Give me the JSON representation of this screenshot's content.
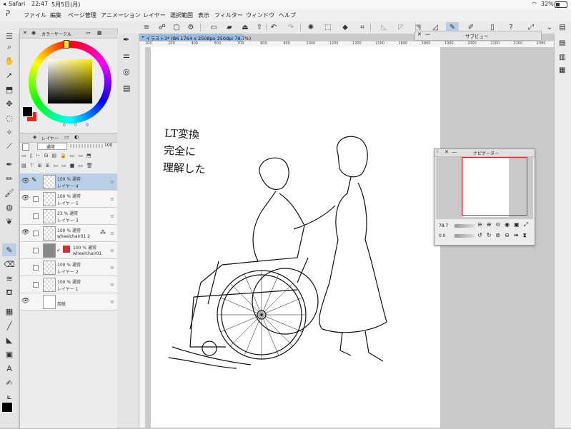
{
  "status_bar": {
    "app": "Safari",
    "time": "22:47",
    "date": "5月5日(月)",
    "battery": "32%"
  },
  "menu": {
    "items": [
      "ファイル",
      "編集",
      "ページ管理",
      "アニメーション",
      "レイヤー",
      "選択範囲",
      "表示",
      "フィルター",
      "ウィンドウ",
      "ヘルプ"
    ]
  },
  "color_panel": {
    "title": "カラーサークル",
    "values": [
      "0",
      "0",
      "0"
    ]
  },
  "layer_panel": {
    "tab_label": "レイヤー",
    "blend_mode": "通常",
    "opacity": "100",
    "layers": [
      {
        "mode": "100 % 通常",
        "name": "レイヤー 4",
        "selected": true,
        "visible": true
      },
      {
        "mode": "100 % 通常",
        "name": "レイヤー 5",
        "selected": false,
        "visible": true
      },
      {
        "mode": "23 % 通常",
        "name": "レイヤー 3",
        "selected": false,
        "visible": false
      },
      {
        "mode": "100 % 通常",
        "name": "wheelchair01 2",
        "selected": false,
        "visible": true
      },
      {
        "mode": "100 % 通常",
        "name": "wheelchair01",
        "selected": false,
        "visible": false
      },
      {
        "mode": "100 % 通常",
        "name": "レイヤー 2",
        "selected": false,
        "visible": false
      },
      {
        "mode": "100 % 通常",
        "name": "レイヤー 1",
        "selected": false,
        "visible": false
      },
      {
        "mode": "",
        "name": "用紙",
        "selected": false,
        "visible": true
      }
    ]
  },
  "document": {
    "tab_title": "イラスト3* (B6 1764 x 2508px 350dpi 78.7%)",
    "ruler_ticks": [
      "100",
      "200",
      "400",
      "500",
      "700",
      "800",
      "900",
      "1000",
      "1200",
      "1300",
      "1500",
      "1600",
      "1800",
      "1900",
      "2000",
      "2100",
      "2200",
      "2380"
    ],
    "handwritten_lines": [
      "LT変換",
      "完全に",
      "理解した"
    ]
  },
  "subview": {
    "title": "サブビュー"
  },
  "navigator": {
    "title": "ナビゲーター",
    "zoom": "78.7",
    "rotation": "0.0"
  },
  "colors": {
    "selection": "#b9cfe8",
    "doc_tab": "#9bbcdf",
    "primary_color": "#000000",
    "secondary_color": "#e8261c"
  }
}
